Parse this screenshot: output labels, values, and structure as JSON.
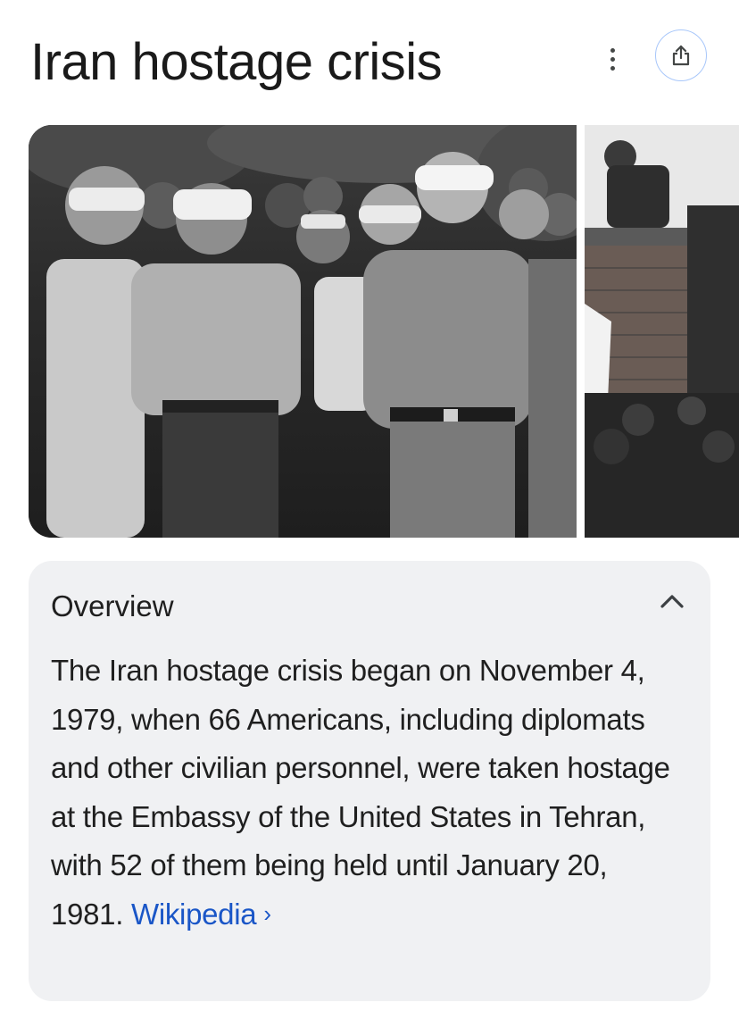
{
  "header": {
    "title": "Iran hostage crisis",
    "more_icon": "more-vert-icon",
    "share_icon": "share-icon"
  },
  "images": {
    "main_alt": "Blindfolded hostages",
    "second_alt": "Embassy wall"
  },
  "overview": {
    "title": "Overview",
    "collapse_icon": "chevron-up-icon",
    "body": "The Iran hostage crisis began on November 4, 1979, when 66 Americans, including diplomats and other civilian personnel, were taken hostage at the Embassy of the United States in Tehran, with 52 of them being held until January 20, 1981.",
    "source_label": "Wikipedia",
    "source_chevron": "›"
  },
  "colors": {
    "link": "#1a56c7",
    "card_bg": "#f0f1f3",
    "share_border": "#a8c7fa"
  }
}
